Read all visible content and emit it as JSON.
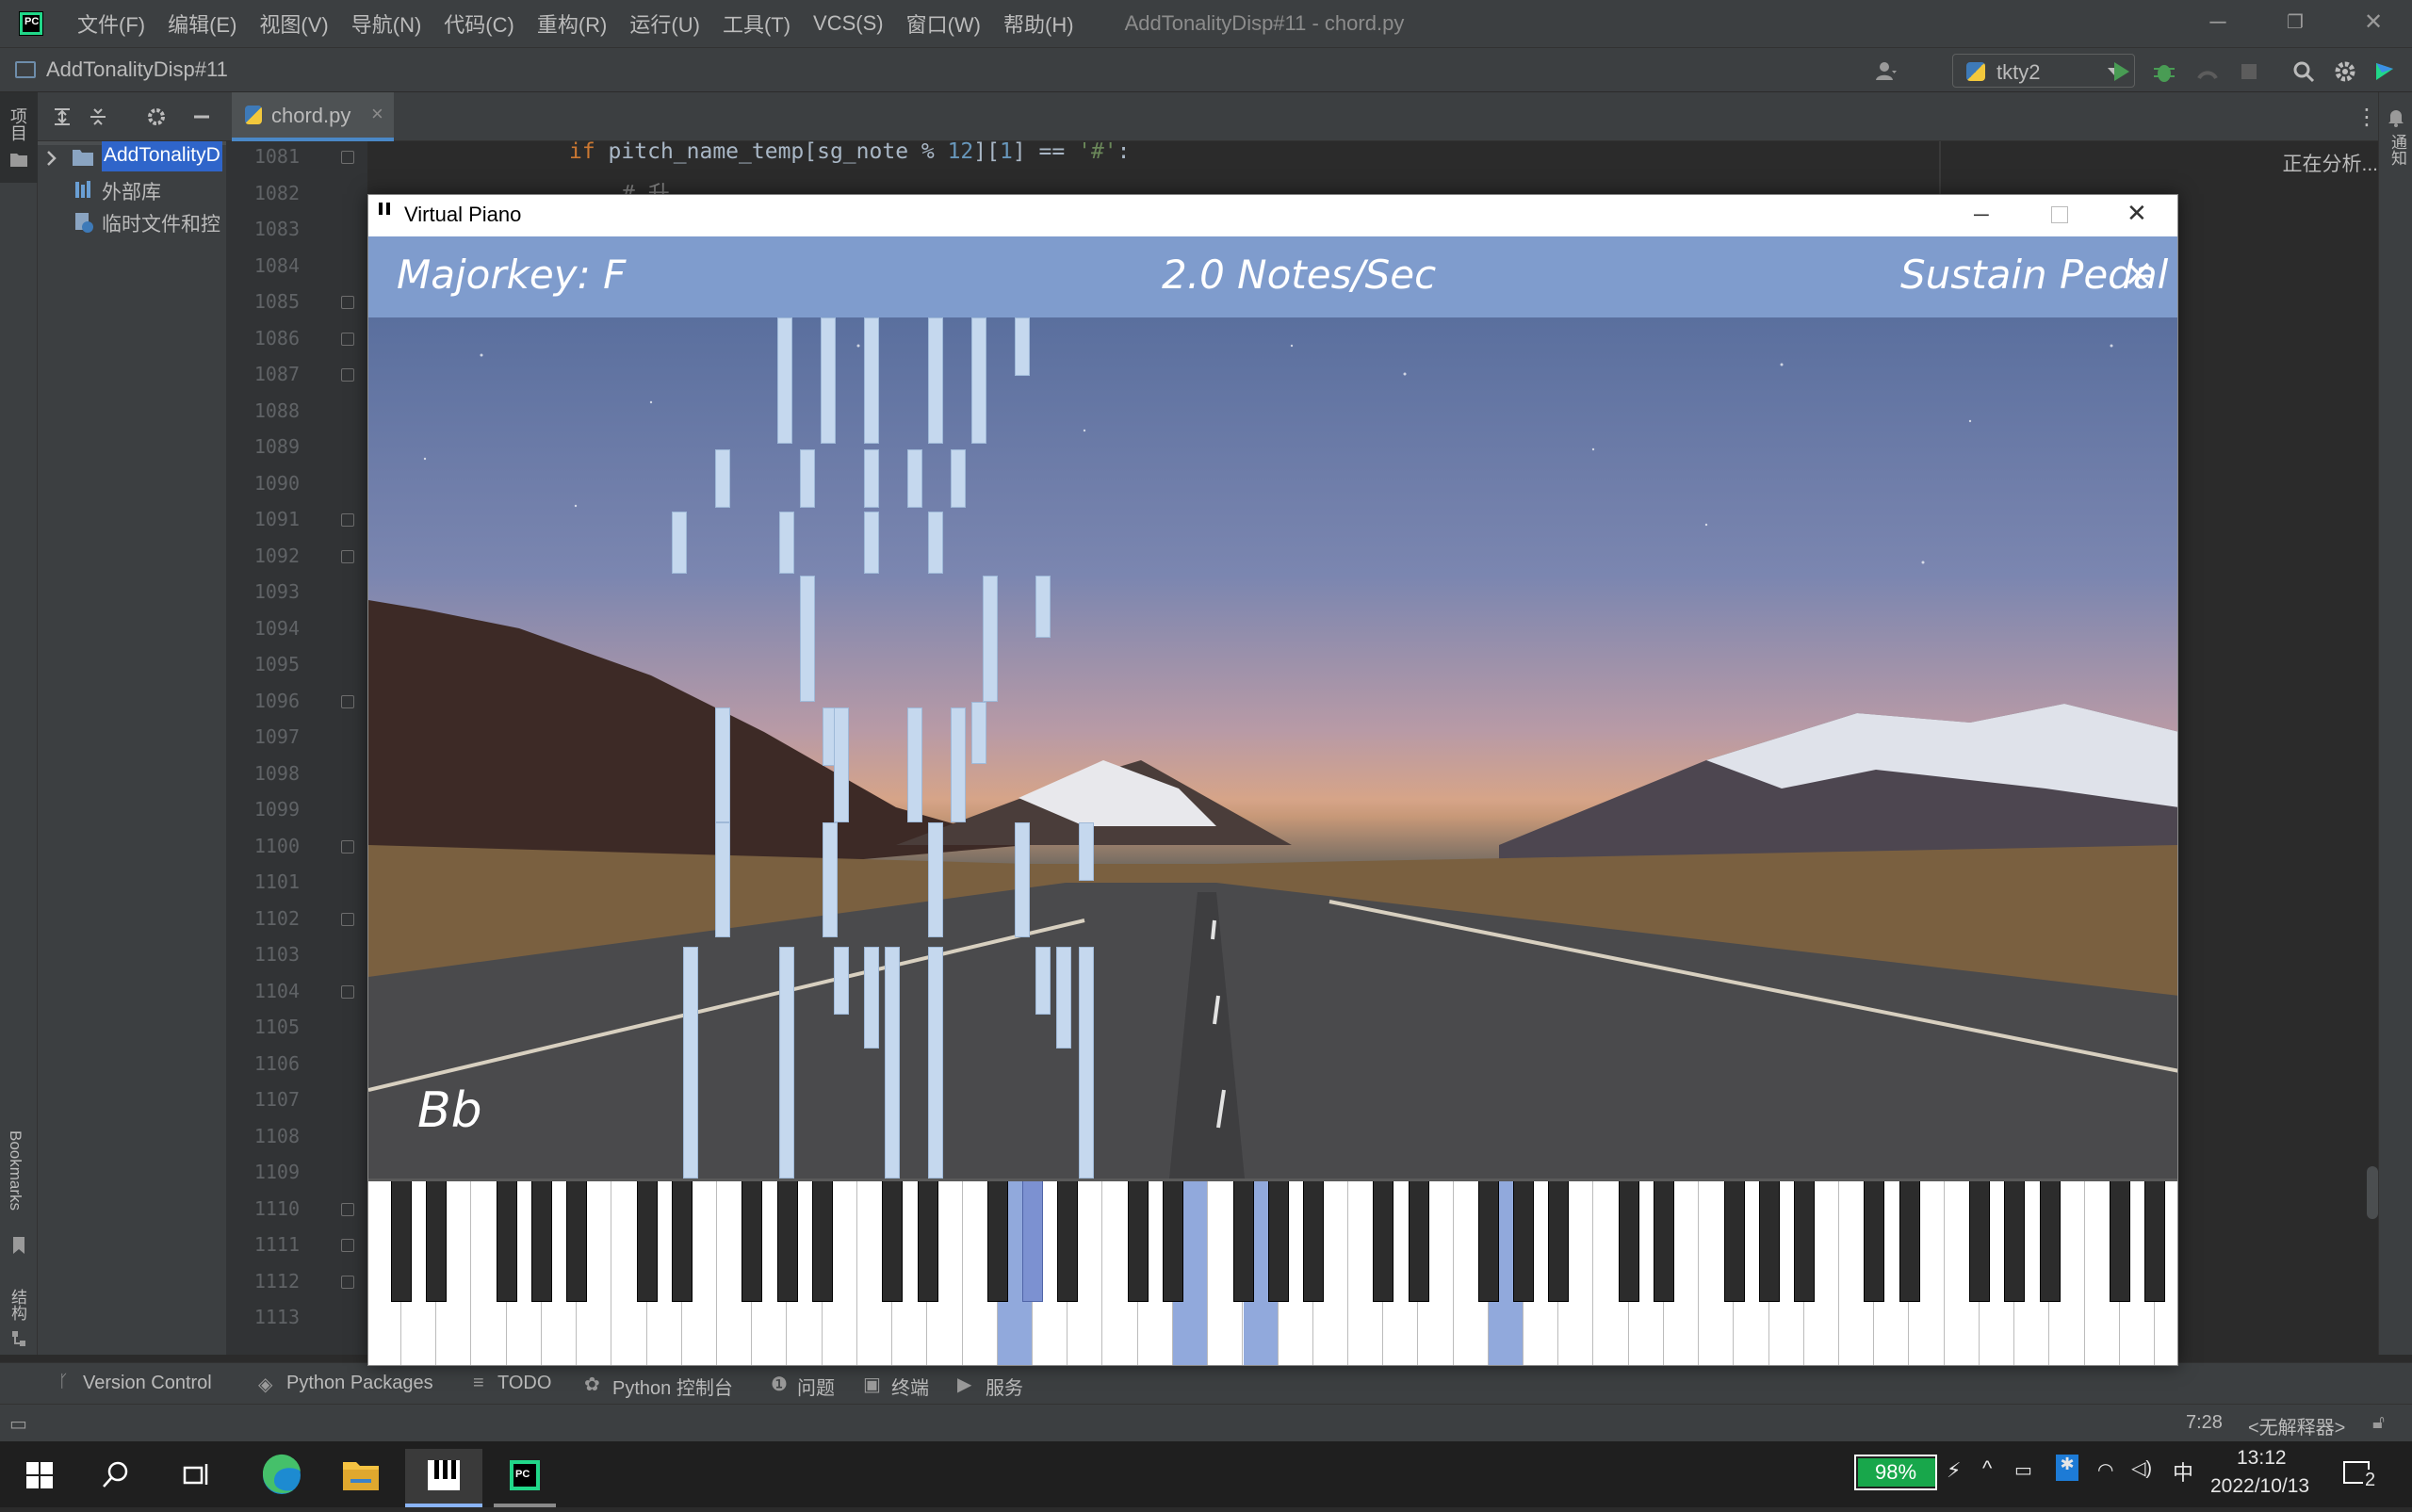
{
  "ide": {
    "menu": [
      "文件(F)",
      "编辑(E)",
      "视图(V)",
      "导航(N)",
      "代码(C)",
      "重构(R)",
      "运行(U)",
      "工具(T)",
      "VCS(S)",
      "窗口(W)",
      "帮助(H)"
    ],
    "window_title": "AddTonalityDisp#11 - chord.py",
    "project_name": "AddTonalityDisp#11",
    "run_config": "tkty2",
    "left_tabs": {
      "project": "项目",
      "bookmarks": "Bookmarks",
      "structure": "结构"
    },
    "right_tabs": {
      "notifications": "通知"
    },
    "tree": [
      "AddTonalityD",
      "外部库",
      "临时文件和控"
    ],
    "tab": {
      "file": "chord.py"
    },
    "line_numbers": [
      "1081",
      "1082",
      "1083",
      "1084",
      "1085",
      "1086",
      "1087",
      "1088",
      "1089",
      "1090",
      "1091",
      "1092",
      "1093",
      "1094",
      "1095",
      "1096",
      "1097",
      "1098",
      "1099",
      "1100",
      "1101",
      "1102",
      "1103",
      "1104",
      "1105",
      "1106",
      "1107",
      "1108",
      "1109",
      "1110",
      "1111",
      "1112",
      "1113"
    ],
    "code": {
      "kw_if": "if",
      "line1081": " pitch_name_temp[sg_note % ",
      "num12": "12",
      "idx": "][",
      "num1": "1",
      "eq": "] == ",
      "str_sharp": "'#'",
      "colon": ":",
      "comment1082": "# 升"
    },
    "analyzing": "正在分析...",
    "bottom_tools": [
      "Version Control",
      "Python Packages",
      "TODO",
      "Python 控制台",
      "问题",
      "终端",
      "服务"
    ],
    "status": {
      "position": "7:28",
      "interpreter": "<无解释器>"
    },
    "taskbar": {
      "battery": "98%",
      "ime": "中",
      "time": "13:12",
      "date": "2022/10/13",
      "notif_count": "2"
    }
  },
  "piano": {
    "window_title": "Virtual Piano",
    "majorkey": "Majorkey: F",
    "notes_rate": "2.0 Notes/Sec",
    "sustain": "Sustain Pedal",
    "close": "×",
    "chord": "Bb",
    "colors": {
      "header": "#7f9ccd",
      "active_key": "#91a9dc",
      "falling_note": "#c5d8ee"
    },
    "active_white_keys": [
      18,
      23,
      25,
      32
    ],
    "active_black_keys": [
      13
    ]
  }
}
